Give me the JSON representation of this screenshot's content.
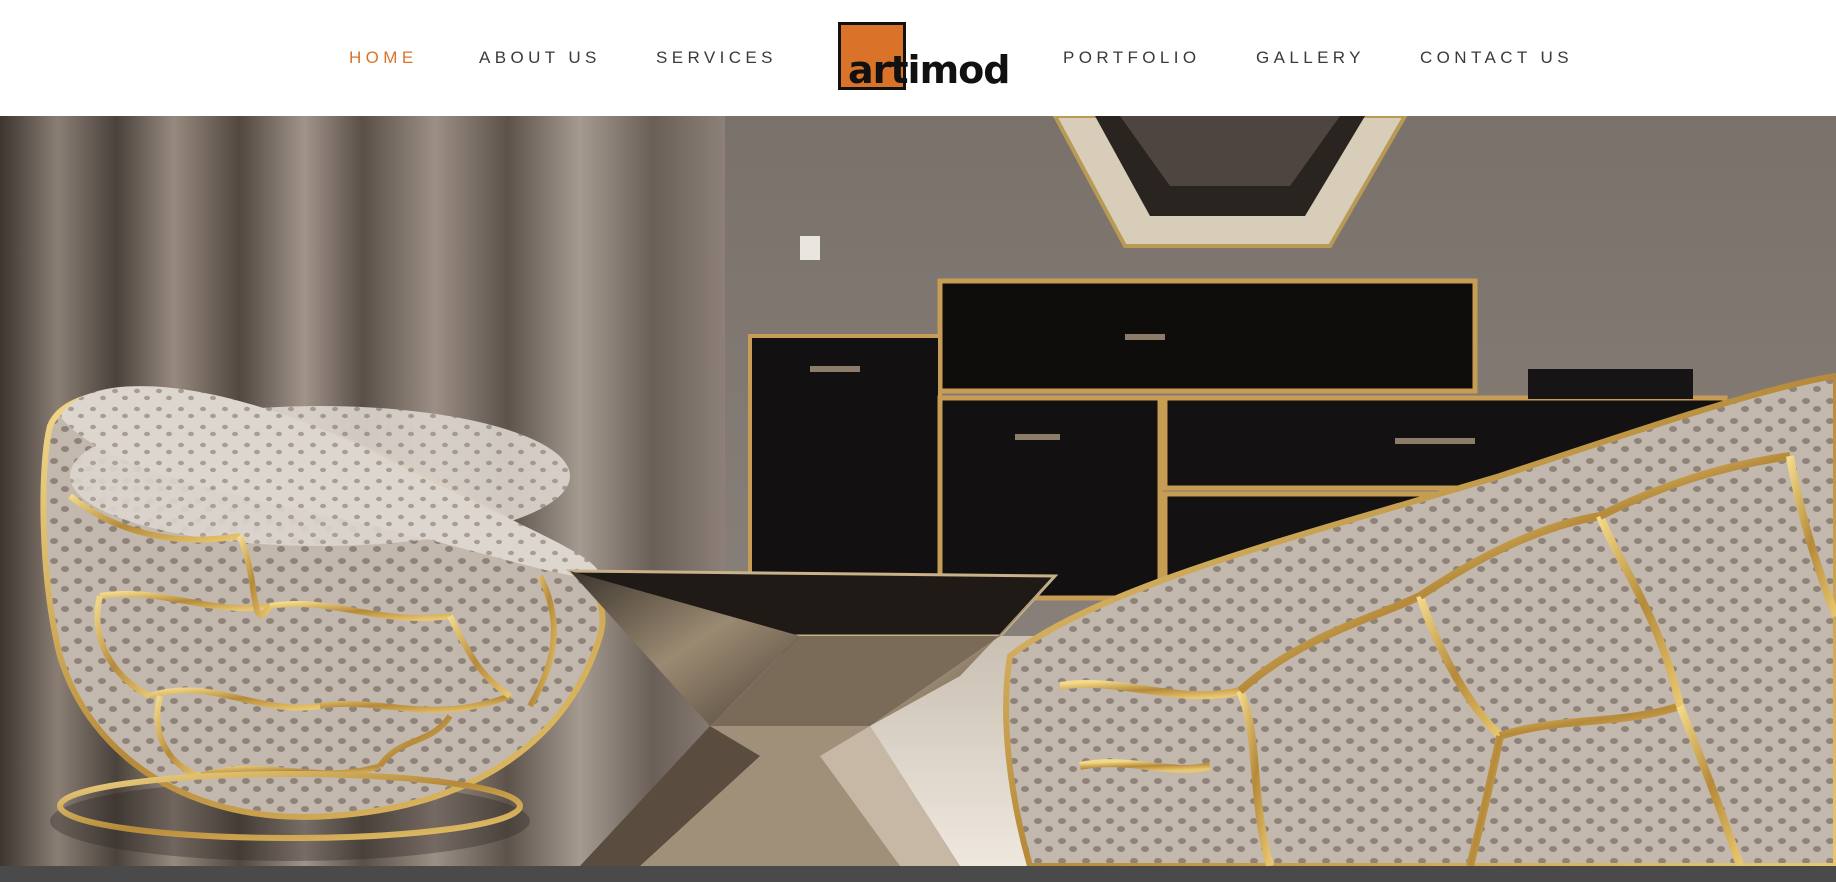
{
  "nav": {
    "left": [
      {
        "label": "HOME",
        "active": true
      },
      {
        "label": "ABOUT US",
        "active": false
      },
      {
        "label": "SERVICES",
        "active": false
      }
    ],
    "right": [
      {
        "label": "PORTFOLIO",
        "active": false
      },
      {
        "label": "GALLERY",
        "active": false
      },
      {
        "label": "CONTACT US",
        "active": false
      }
    ]
  },
  "logo": {
    "text": "artimod",
    "box_color": "#d9732a"
  },
  "colors": {
    "accent": "#d9732a",
    "nav_text": "#3a3a3a",
    "footer_bar": "#4a4a4a"
  }
}
